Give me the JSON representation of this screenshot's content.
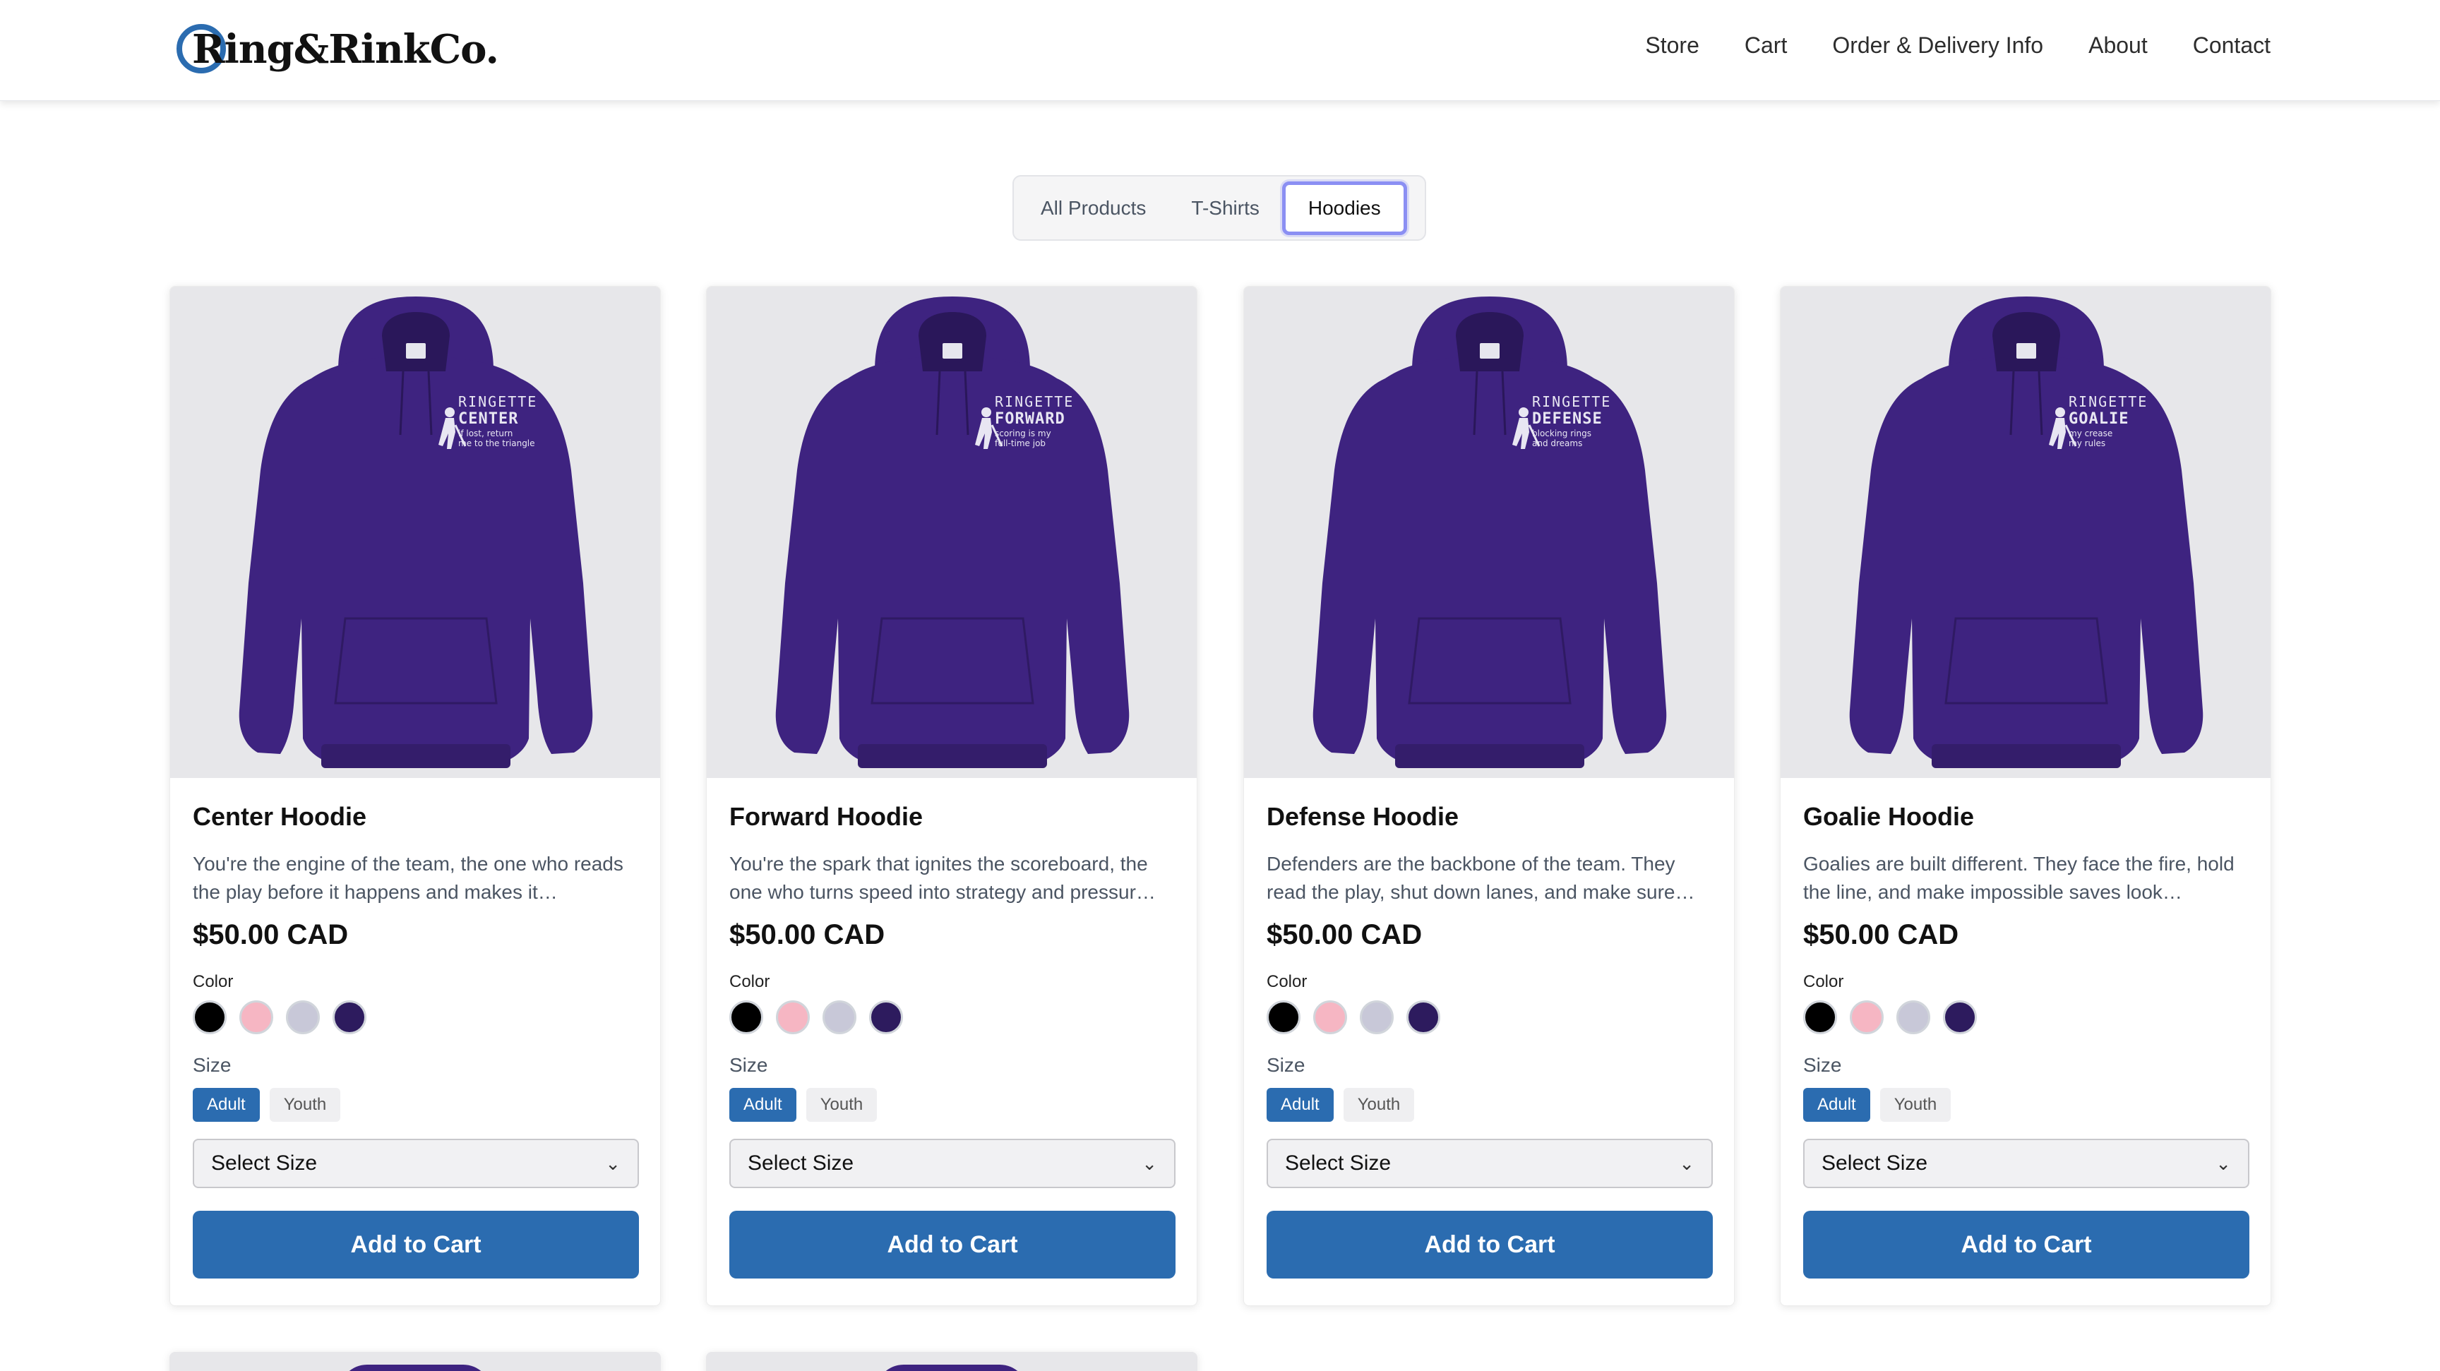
{
  "brand": {
    "name": "Ring&RinkCo."
  },
  "nav": {
    "items": [
      {
        "label": "Store"
      },
      {
        "label": "Cart"
      },
      {
        "label": "Order & Delivery Info"
      },
      {
        "label": "About"
      },
      {
        "label": "Contact"
      }
    ]
  },
  "filters": {
    "tabs": [
      {
        "label": "All Products",
        "active": false
      },
      {
        "label": "T-Shirts",
        "active": false
      },
      {
        "label": "Hoodies",
        "active": true
      }
    ]
  },
  "colors": {
    "accent": "#2b6cb0",
    "hoodie": "#3e2380",
    "swatches": [
      "#000000",
      "#f6b6c3",
      "#c8c8d8",
      "#2d1b5e"
    ]
  },
  "products": [
    {
      "title": "Center Hoodie",
      "description": "You're the engine of the team, the one who reads the play before it happens and makes it…",
      "price": "$50.00 CAD",
      "color_label": "Color",
      "size_label": "Size",
      "size_options": [
        "Adult",
        "Youth"
      ],
      "selected_size_group": "Adult",
      "select_placeholder": "Select Size",
      "button_label": "Add to Cart",
      "print": {
        "line1": "RINGETTE",
        "line2": "CENTER",
        "line3": "if lost, return",
        "line4": "me to the triangle"
      }
    },
    {
      "title": "Forward Hoodie",
      "description": "You're the spark that ignites the scoreboard, the one who turns speed into strategy and pressur…",
      "price": "$50.00 CAD",
      "color_label": "Color",
      "size_label": "Size",
      "size_options": [
        "Adult",
        "Youth"
      ],
      "selected_size_group": "Adult",
      "select_placeholder": "Select Size",
      "button_label": "Add to Cart",
      "print": {
        "line1": "RINGETTE",
        "line2": "FORWARD",
        "line3": "scoring is my",
        "line4": "full-time job"
      }
    },
    {
      "title": "Defense Hoodie",
      "description": "Defenders are the backbone of the team. They read the play, shut down lanes, and make sure…",
      "price": "$50.00 CAD",
      "color_label": "Color",
      "size_label": "Size",
      "size_options": [
        "Adult",
        "Youth"
      ],
      "selected_size_group": "Adult",
      "select_placeholder": "Select Size",
      "button_label": "Add to Cart",
      "print": {
        "line1": "RINGETTE",
        "line2": "DEFENSE",
        "line3": "blocking rings",
        "line4": "and dreams"
      }
    },
    {
      "title": "Goalie Hoodie",
      "description": "Goalies are built different. They face the fire, hold the line, and make impossible saves look…",
      "price": "$50.00 CAD",
      "color_label": "Color",
      "size_label": "Size",
      "size_options": [
        "Adult",
        "Youth"
      ],
      "selected_size_group": "Adult",
      "select_placeholder": "Select Size",
      "button_label": "Add to Cart",
      "print": {
        "line1": "RINGETTE",
        "line2": "GOALIE",
        "line3": "my crease",
        "line4": "my rules"
      }
    }
  ]
}
